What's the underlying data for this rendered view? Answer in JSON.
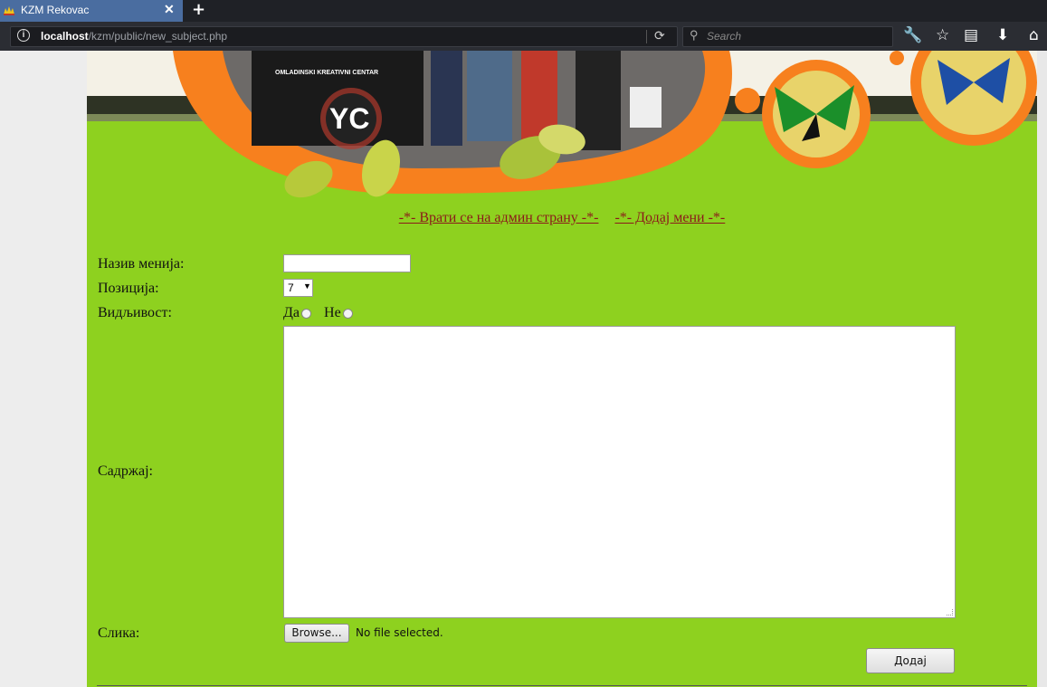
{
  "browser": {
    "tab_title": "KZM Rekovac",
    "new_tab": "+",
    "url_host": "localhost",
    "url_path": "/kzm/public/new_subject.php",
    "search_placeholder": "Search"
  },
  "header": {
    "banner_text": "OMLADINSKI KREATIVNI CENTAR",
    "logo_text": "YC"
  },
  "nav": {
    "back_link": "-*- Врати се на админ страну -*-",
    "add_link": "-*- Додај мени -*-"
  },
  "form": {
    "name_label": "Назив менија:",
    "name_value": "",
    "position_label": "Позиција:",
    "position_value": "7",
    "visibility_label": "Видљивост:",
    "visibility_yes": "Да",
    "visibility_no": "Не",
    "content_label": "Садржај:",
    "content_value": "",
    "image_label": "Слика:",
    "browse_button": "Browse...",
    "no_file": "No file selected.",
    "submit_button": "Додај"
  },
  "colors": {
    "page_bg": "#8ed11f",
    "link": "#8b1a1a",
    "accent_orange": "#f7801e"
  }
}
